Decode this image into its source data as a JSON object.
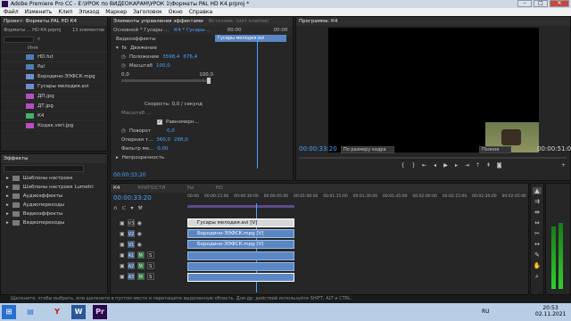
{
  "window": {
    "title": "Adobe Premiere Pro CC - E:\\УРОК по ВИДЕОКАРАМ\\УРОК 1\\Форматы PAL HD К4.prproj *"
  },
  "menu": [
    "Файл",
    "Изменить",
    "Клип",
    "Эпизод",
    "Маркер",
    "Заголовок",
    "Окно",
    "Справка"
  ],
  "project": {
    "tab": "Проект: Форматы PAL HD К4",
    "path": "Форматы ... HD К4.prproj",
    "count": "13 элементов",
    "col_name": "Имя",
    "items": [
      {
        "name": "HD.fut",
        "color": "#4b7fb5"
      },
      {
        "name": "Pal",
        "color": "#4b7fb5"
      },
      {
        "name": "Бородино-ЭЭФСК.mpg",
        "color": "#6d8fd1"
      },
      {
        "name": "Гусары мелодия.avi",
        "color": "#6d8fd1"
      },
      {
        "name": "ДП.jpg",
        "color": "#b64fc0"
      },
      {
        "name": "ДТ.jpg",
        "color": "#b64fc0"
      },
      {
        "name": "К4",
        "color": "#3fb36a"
      },
      {
        "name": "Кодак.veri.jpg",
        "color": "#b64fc0"
      }
    ]
  },
  "effect_controls": {
    "tabs": [
      "Элементы управления эффектами",
      "Источник: (нет клипов)"
    ],
    "source": "Основной * Гусары ...",
    "clip": "К4 * Гусары ...",
    "time_start": "00:00",
    "time_end": "00:00",
    "clip_label": "Гусары мелодия.avi",
    "section": "Видеоэффекты",
    "motion": "Движение",
    "rows": {
      "position": {
        "label": "Положение",
        "v1": "3598,4",
        "v2": "676,4"
      },
      "scale": {
        "label": "Масштаб",
        "v1": "100,0"
      },
      "scale_min": "0,0",
      "scale_max": "100,0",
      "speed": "Скорость: 0,0 / секунд",
      "speed_val": "0,0",
      "scale_width": "Масштаб ...",
      "uniform": "Равномерн...",
      "rotation": {
        "label": "Поворот",
        "v1": "0,0"
      },
      "anchor": {
        "label": "Опорная т...",
        "v1": "360,0",
        "v2": "288,0"
      },
      "flicker": {
        "label": "Фильтр ме...",
        "v1": "0,00"
      },
      "opacity": "Непрозрачность"
    },
    "timecode": "00:00:33:20"
  },
  "program": {
    "tab": "Программа: К4",
    "timecode_left": "00:00:33:20",
    "fit": "По размеру кадра",
    "quality": "Полное",
    "timecode_right": "00:00:51:08"
  },
  "effects": {
    "tab": "Эффекты",
    "folders": [
      "Шаблоны настроек",
      "Шаблоны настроек Lumetri",
      "Аудиоэффекты",
      "Аудиопереходы",
      "Видеоэффекты",
      "Видеопереходы"
    ]
  },
  "timeline": {
    "tabs": [
      "К4",
      "КРИПОСТИ",
      "Pal",
      "HD"
    ],
    "timecode": "00:00:33:20",
    "ruler": [
      "00:00",
      "00:00:15:00",
      "00:00:30:00",
      "00:00:45:00",
      "00:01:00:00",
      "00:01:15:00",
      "00:01:30:00",
      "00:01:45:00",
      "00:02:00:00",
      "00:02:15:00",
      "00:02:30:00",
      "00:02:45:00"
    ],
    "tracks": [
      "V3",
      "V2",
      "V1",
      "A1",
      "A2",
      "A3"
    ],
    "clips": {
      "v3": "Гусары мелодия.avi [V]",
      "v2": "Бородино-ЭЭФСК.mpg [V]",
      "v1": "Бородино-ЭЭФСК.mpg [V]"
    }
  },
  "status_bar": "Щелкните, чтобы выбрать, или щелкните в пустом месте и перетащите выделенную область. Для др. действий используйте SHIFT, ALT и CTRL.",
  "taskbar": {
    "lang": "RU",
    "time": "20:53",
    "date": "02.11.2021"
  }
}
